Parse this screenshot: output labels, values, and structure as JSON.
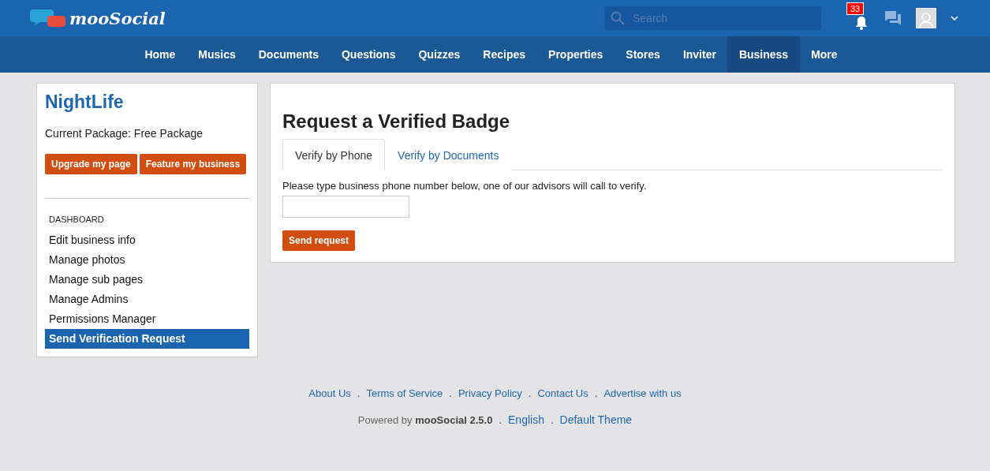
{
  "header": {
    "logo": "mooSocial",
    "search": {
      "placeholder": "Search"
    },
    "notifications": {
      "count": "33"
    }
  },
  "nav": [
    {
      "label": "Home",
      "selected": false
    },
    {
      "label": "Musics",
      "selected": false
    },
    {
      "label": "Documents",
      "selected": false
    },
    {
      "label": "Questions",
      "selected": false
    },
    {
      "label": "Quizzes",
      "selected": false
    },
    {
      "label": "Recipes",
      "selected": false
    },
    {
      "label": "Properties",
      "selected": false
    },
    {
      "label": "Stores",
      "selected": false
    },
    {
      "label": "Inviter",
      "selected": false
    },
    {
      "label": "Business",
      "selected": true
    },
    {
      "label": "More",
      "selected": false
    }
  ],
  "sidebar": {
    "title": "NightLife",
    "package": "Current Package: Free Package",
    "buttons": [
      "Upgrade my page",
      "Feature my business"
    ],
    "section": "DASHBOARD",
    "items": [
      {
        "label": "Edit business info",
        "selected": false
      },
      {
        "label": "Manage photos",
        "selected": false
      },
      {
        "label": "Manage sub pages",
        "selected": false
      },
      {
        "label": "Manage Admins",
        "selected": false
      },
      {
        "label": "Permissions Manager",
        "selected": false
      },
      {
        "label": "Send Verification Request",
        "selected": true
      }
    ]
  },
  "main": {
    "title": "Request a Verified Badge",
    "tabs": [
      {
        "label": "Verify by Phone",
        "selected": true
      },
      {
        "label": "Verify by Documents",
        "selected": false
      }
    ],
    "instruction": "Please type business phone number below, one of our advisors will call to verify.",
    "submit": "Send request"
  },
  "footer": {
    "links": [
      {
        "kind": "link",
        "text": "About Us"
      },
      {
        "kind": "separator",
        "text": "."
      },
      {
        "kind": "link",
        "text": "Terms of Service"
      },
      {
        "kind": "separator",
        "text": "."
      },
      {
        "kind": "link",
        "text": "Privacy Policy"
      },
      {
        "kind": "separator",
        "text": "."
      },
      {
        "kind": "link",
        "text": "Contact Us"
      },
      {
        "kind": "separator",
        "text": "."
      },
      {
        "kind": "link",
        "text": "Advertise with us"
      }
    ],
    "bottom": [
      {
        "kind": "text",
        "text": "Powered by **mooSocial 2.5.0**"
      },
      {
        "kind": "separator",
        "text": "."
      },
      {
        "kind": "link",
        "text": "English"
      },
      {
        "kind": "separator",
        "text": "."
      },
      {
        "kind": "link",
        "text": "Default Theme"
      }
    ]
  }
}
